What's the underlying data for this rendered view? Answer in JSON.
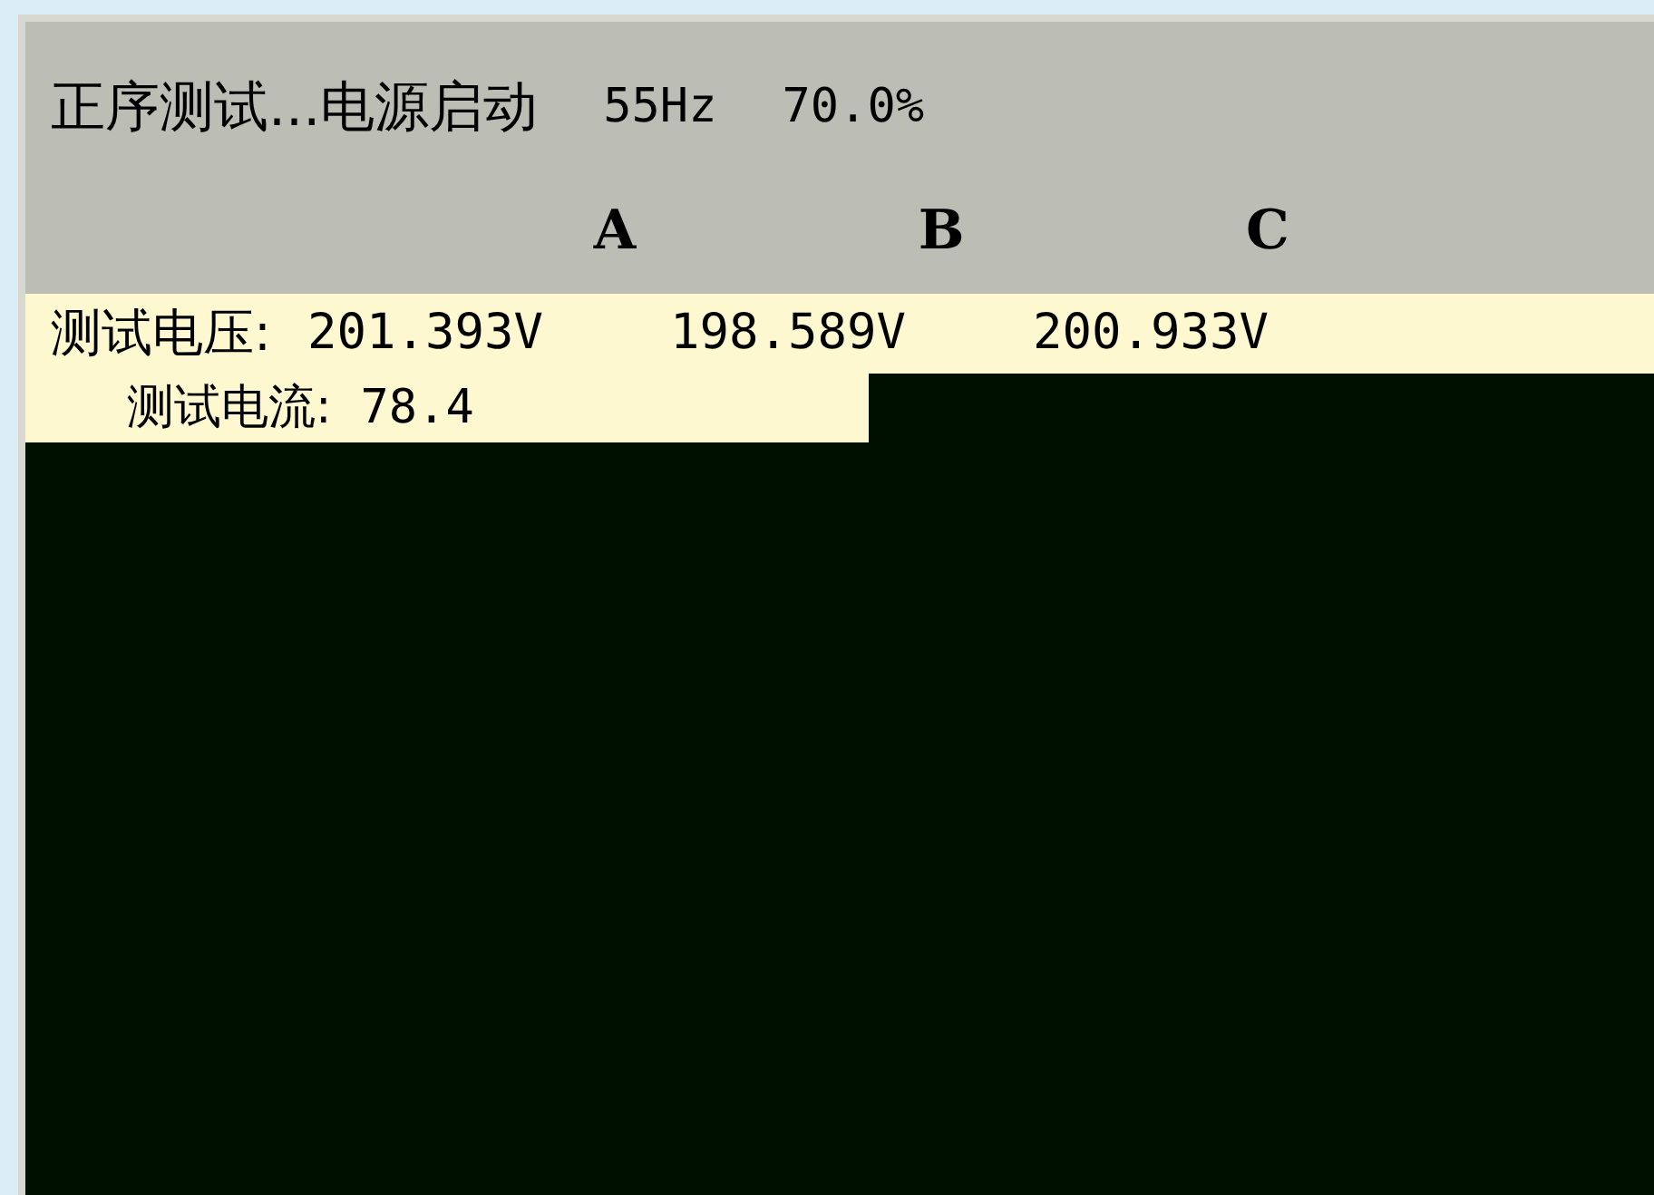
{
  "header": {
    "title": "正序测试...电源启动",
    "frequency": "55Hz",
    "percent": "70.0%"
  },
  "phases": [
    "A",
    "B",
    "C"
  ],
  "rows": [
    {
      "label": "测试电压:",
      "values": [
        "201.393V",
        "198.589V",
        "200.933V"
      ]
    },
    {
      "label": "测试电流:",
      "values": [
        "78.4"
      ]
    }
  ]
}
